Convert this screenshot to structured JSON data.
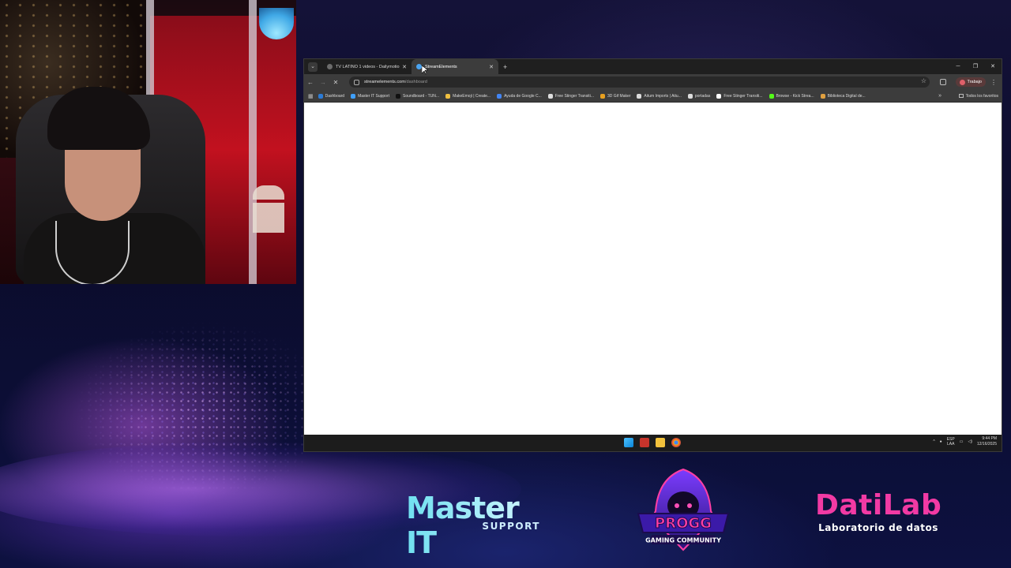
{
  "browser": {
    "tabs": [
      {
        "title": "TV LATINO 1 videos - Dailymotion",
        "favicon_color": "#6c6c6c",
        "active": false
      },
      {
        "title": "StreamElements",
        "favicon_color": "#4aa3f0",
        "active": true
      }
    ],
    "new_tab_label": "+",
    "url_host": "streamelements.com",
    "url_path": "/dashboard",
    "profile_name": "Trabajo",
    "bookmarks": [
      {
        "label": "Dashboard",
        "color": "#2b7bd6"
      },
      {
        "label": "Master IT Support",
        "color": "#3fa0ff"
      },
      {
        "label": "Soundboard - TUN...",
        "color": "#111111"
      },
      {
        "label": "MakeEmoji | Create...",
        "color": "#f0c040"
      },
      {
        "label": "Ayuda de Google C...",
        "color": "#4285f4"
      },
      {
        "label": "Free Stinger Transiti...",
        "color": "#dddddd"
      },
      {
        "label": "3D Gif Maker",
        "color": "#e8a020"
      },
      {
        "label": "Aitum Imports | Aitu...",
        "color": "#dddddd"
      },
      {
        "label": "portadas",
        "color": "#dddddd"
      },
      {
        "label": "Free Stinger Transiti...",
        "color": "#ffffff"
      },
      {
        "label": "Browse - Kick Strea...",
        "color": "#53fc18"
      },
      {
        "label": "Biblioteca Digital de...",
        "color": "#e0a040"
      }
    ],
    "all_bookmarks_label": "Todos los favoritos"
  },
  "taskbar": {
    "language_top": "ESP",
    "language_bottom": "LAA",
    "time": "9:44 PM",
    "date": "12/16/2025"
  },
  "overlay": {
    "master_it": {
      "title": "Master IT",
      "subtitle": "SUPPORT"
    },
    "progg": {
      "title": "PROGG",
      "subtitle": "GAMING COMMUNITY"
    },
    "datilab": {
      "title": "DatiLab",
      "subtitle": "Laboratorio de datos"
    }
  }
}
